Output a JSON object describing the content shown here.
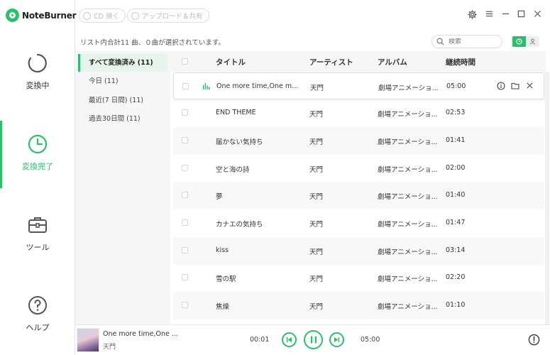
{
  "app": {
    "name": "NoteBurner"
  },
  "toolbar": {
    "burn_cd": "CD 焼く",
    "upload_share": "アップロード＆共有"
  },
  "nav": [
    {
      "label": "変換中",
      "icon": "converting-circle-icon"
    },
    {
      "label": "変換完了",
      "icon": "clock-icon",
      "active": true
    },
    {
      "label": "ツール",
      "icon": "toolbox-icon"
    },
    {
      "label": "ヘルプ",
      "icon": "help-icon"
    }
  ],
  "summary": "リスト内合計11 曲、０曲が選択されています。",
  "search": {
    "placeholder": "検索"
  },
  "filters": [
    {
      "label": "すべて変換済み (11)",
      "active": true
    },
    {
      "label": "今日 (11)"
    },
    {
      "label": "最近(7 日間) (11)"
    },
    {
      "label": "過去30日間 (11)"
    }
  ],
  "columns": {
    "title": "タイトル",
    "artist": "アーティスト",
    "album": "アルバム",
    "duration": "継続時間"
  },
  "tracks": [
    {
      "title": "One more time,One more ...",
      "artist": "天門",
      "album": "劇場アニメーショ...",
      "duration": "05:00",
      "playing": true
    },
    {
      "title": "END THEME",
      "artist": "天門",
      "album": "劇場アニメーショ...",
      "duration": "02:53"
    },
    {
      "title": "届かない気持ち",
      "artist": "天門",
      "album": "劇場アニメーショ...",
      "duration": "01:41"
    },
    {
      "title": "空と海の詩",
      "artist": "天門",
      "album": "劇場アニメーショ...",
      "duration": "02:00"
    },
    {
      "title": "夢",
      "artist": "天門",
      "album": "劇場アニメーショ...",
      "duration": "01:40"
    },
    {
      "title": "カナエの気持ち",
      "artist": "天門",
      "album": "劇場アニメーショ...",
      "duration": "01:47"
    },
    {
      "title": "kiss",
      "artist": "天門",
      "album": "劇場アニメーショ...",
      "duration": "03:14"
    },
    {
      "title": "雪の駅",
      "artist": "天門",
      "album": "劇場アニメーショ...",
      "duration": "02:20"
    },
    {
      "title": "焦燥",
      "artist": "天門",
      "album": "劇場アニメーショ...",
      "duration": "01:10"
    }
  ],
  "player": {
    "title": "One more time,One ...",
    "artist": "天門",
    "elapsed": "00:01",
    "total": "05:00"
  },
  "colors": {
    "accent": "#2bbf6a",
    "text": "#333333",
    "panel": "#f6f6f6"
  }
}
